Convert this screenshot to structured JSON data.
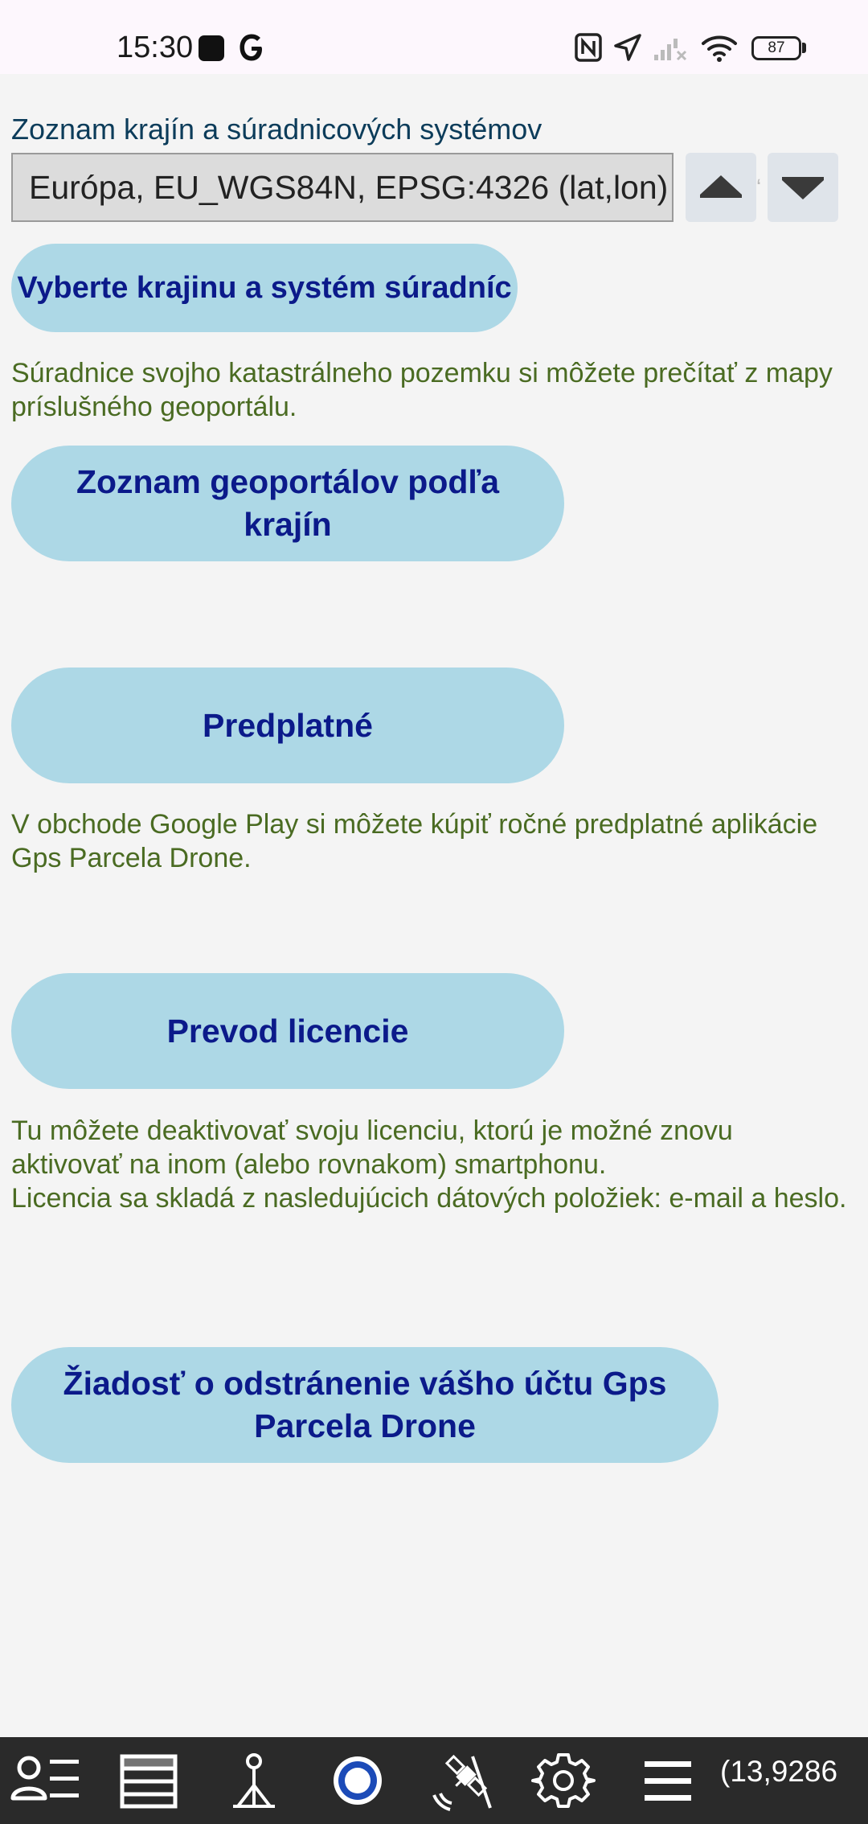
{
  "status_bar": {
    "time": "15:30",
    "battery": "87",
    "icons": [
      "app-notification-icon",
      "google-icon",
      "nfc-icon",
      "location-arrow-icon",
      "cell-signal-off-icon",
      "wifi-icon",
      "battery-icon"
    ]
  },
  "crs": {
    "label": "Zoznam krajín a súradnicových systémov",
    "selected": "Európa, EU_WGS84N, EPSG:4326 (lat,lon)",
    "up_icon": "triangle-up-icon",
    "down_icon": "triangle-down-icon"
  },
  "buttons": {
    "select_country": "Vyberte krajinu a systém súradníc",
    "geoportals": "Zoznam geoportálov podľa krajín",
    "subscription": "Predplatné",
    "license_transfer": "Prevod licencie",
    "delete_account": "Žiadosť o odstránenie vášho účtu Gps Parcela Drone"
  },
  "texts": {
    "coordinates_info": "Súradnice svojho katastrálneho pozemku si môžete prečítať z mapy príslušného geoportálu.",
    "subscription_info": "V obchode Google Play si môžete kúpiť ročné predplatné aplikácie Gps Parcela Drone.",
    "license_info_1": "Tu môžete deaktivovať svoju licenciu, ktorú je možné znovu aktivovať na inom (alebo rovnakom) smartphonu.",
    "license_info_2": "Licencia sa skladá z nasledujúcich dátových položiek: e-mail a heslo."
  },
  "toolbar": {
    "coordinates": "(13,9286",
    "items": [
      "user-list-icon",
      "layers-list-icon",
      "survey-point-icon",
      "record-icon",
      "satellite-icon",
      "settings-gear-icon",
      "menu-icon"
    ]
  },
  "colors": {
    "button_bg": "#add8e6",
    "button_text": "#0b1a8a",
    "info_text": "#4a6b22",
    "label_text": "#0c3c5a",
    "toolbar_bg": "#2a2a2a"
  }
}
